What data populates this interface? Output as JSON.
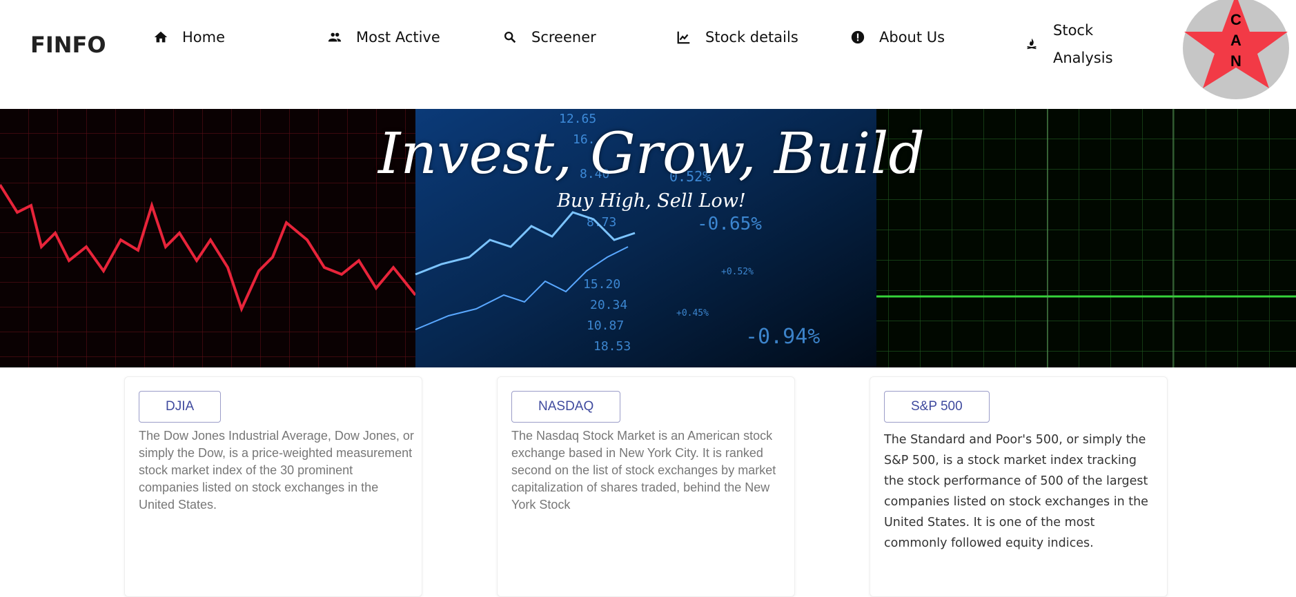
{
  "nav": {
    "brand": "FINFO",
    "items": [
      {
        "label": "Home",
        "icon": "home-icon"
      },
      {
        "label": "Most Active",
        "icon": "people-icon"
      },
      {
        "label": "Screener",
        "icon": "search-icon"
      },
      {
        "label": "Stock details",
        "icon": "chart-icon"
      },
      {
        "label": "About Us",
        "icon": "info-icon"
      },
      {
        "label_line1": "Stock",
        "label_line2": "Analysis",
        "icon": "campfire-icon"
      }
    ],
    "logo_text": "CAN"
  },
  "hero": {
    "title": "Invest, Grow, Build",
    "subtitle": "Buy High, Sell Low!"
  },
  "cards": [
    {
      "button": "DJIA",
      "text": "The Dow Jones Industrial Average, Dow Jones, or simply the Dow, is a price-weighted measurement stock market index of the 30 prominent companies listed on stock exchanges in the United States."
    },
    {
      "button": "NASDAQ",
      "text": "The Nasdaq Stock Market is an American stock exchange based in New York City. It is ranked second on the list of stock exchanges by market capitalization of shares traded, behind the New York Stock"
    },
    {
      "button": "S&P 500",
      "text": "The Standard and Poor's 500, or simply the S&P 500, is a stock market index tracking the stock performance of 500 of the largest companies listed on stock exchanges in the United States. It is one of the most commonly followed equity indices."
    }
  ]
}
